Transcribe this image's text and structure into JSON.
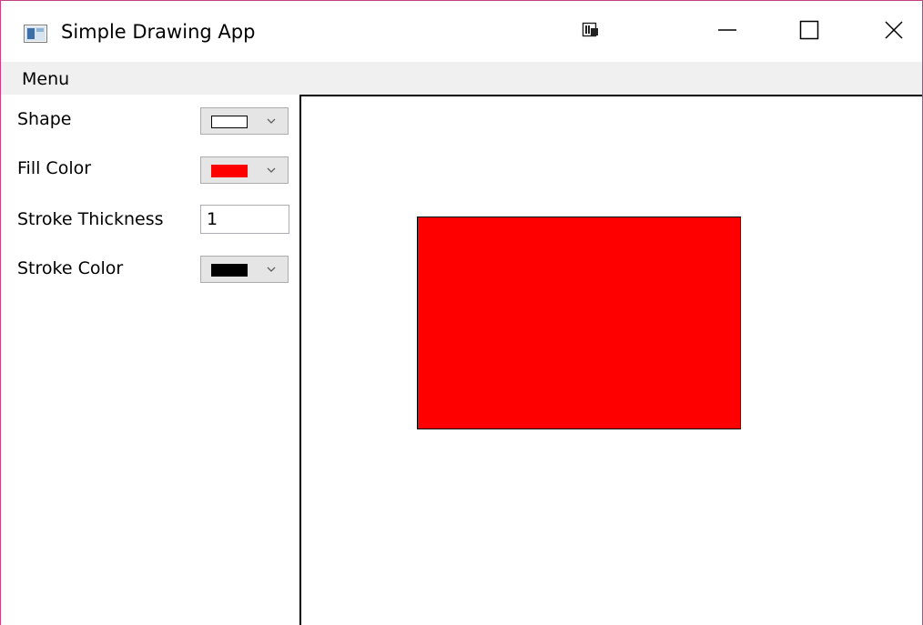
{
  "window": {
    "title": "Simple Drawing App",
    "border_color": "#c2437f"
  },
  "caption_buttons": {
    "extra_icon": "snap-window-icon",
    "minimize_icon": "minimize-icon",
    "maximize_icon": "maximize-icon",
    "close_icon": "close-icon"
  },
  "menubar": {
    "items": [
      {
        "label": "Menu"
      }
    ]
  },
  "properties": {
    "shape": {
      "label": "Shape",
      "selected": "rectangle",
      "swatch_color": "#ffffff"
    },
    "fill_color": {
      "label": "Fill Color",
      "selected": "#ff0000"
    },
    "stroke_thickness": {
      "label": "Stroke Thickness",
      "value": "1"
    },
    "stroke_color": {
      "label": "Stroke Color",
      "selected": "#000000"
    }
  },
  "canvas": {
    "shapes": [
      {
        "type": "rectangle",
        "fill": "#ff0000",
        "stroke": "#000000",
        "stroke_thickness": 1
      }
    ]
  }
}
